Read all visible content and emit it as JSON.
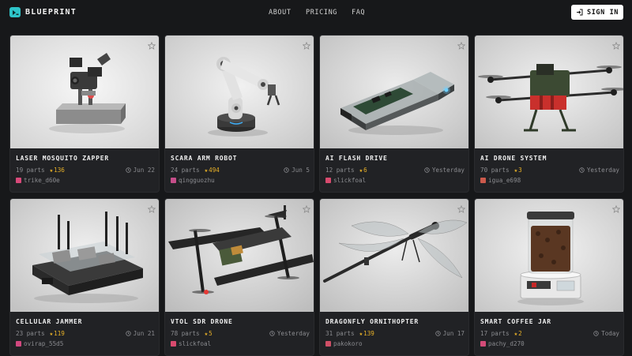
{
  "header": {
    "logo_text": "BLUEPRINT",
    "nav": [
      "ABOUT",
      "PRICING",
      "FAQ"
    ],
    "signin_label": "SIGN IN"
  },
  "cards": [
    {
      "title": "LASER MOSQUITO ZAPPER",
      "parts": "19 parts",
      "likes": "136",
      "time": "Jun 22",
      "owner": "trike_d60e",
      "avatar_color": "#d8497a"
    },
    {
      "title": "SCARA ARM ROBOT",
      "parts": "24 parts",
      "likes": "494",
      "time": "Jun 5",
      "owner": "qingguozhu",
      "avatar_color": "#c64e8a"
    },
    {
      "title": "AI FLASH DRIVE",
      "parts": "12 parts",
      "likes": "6",
      "time": "Yesterday",
      "owner": "slickfoal",
      "avatar_color": "#d84a6e"
    },
    {
      "title": "AI DRONE SYSTEM",
      "parts": "70 parts",
      "likes": "3",
      "time": "Yesterday",
      "owner": "igua_e698",
      "avatar_color": "#cc5a4c"
    },
    {
      "title": "CELLULAR JAMMER",
      "parts": "23 parts",
      "likes": "119",
      "time": "Jun 21",
      "owner": "ovirap_55d5",
      "avatar_color": "#d1487f"
    },
    {
      "title": "VTOL SDR DRONE",
      "parts": "78 parts",
      "likes": "5",
      "time": "Yesterday",
      "owner": "slickfoal",
      "avatar_color": "#d84a6e"
    },
    {
      "title": "DRAGONFLY ORNITHOPTER",
      "parts": "31 parts",
      "likes": "139",
      "time": "Jun 17",
      "owner": "pakokoro",
      "avatar_color": "#cf4f66"
    },
    {
      "title": "SMART COFFEE JAR",
      "parts": "17 parts",
      "likes": "2",
      "time": "Today",
      "owner": "pachy_d270",
      "avatar_color": "#d34b78"
    }
  ]
}
